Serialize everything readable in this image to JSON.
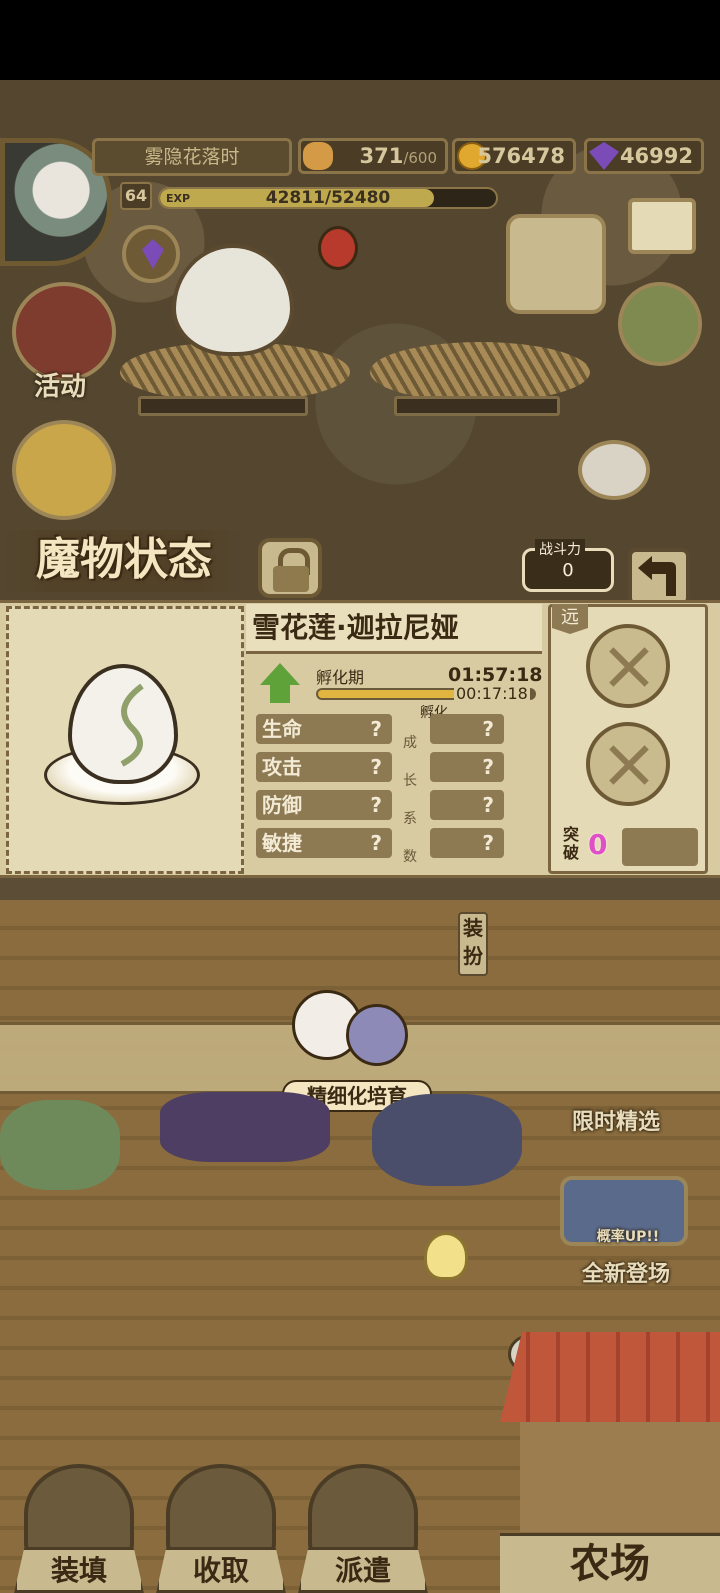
{
  "player": {
    "name": "雾隐花落时",
    "level": "64",
    "exp_label": "EXP",
    "exp_text": "42811/52480",
    "exp_progress": 0.816
  },
  "resources": {
    "bread_current": "371",
    "bread_max": "/600",
    "gold": "576478",
    "gems": "46992"
  },
  "side_menu": {
    "activity": "活动"
  },
  "status": {
    "title": "魔物状态",
    "power_label": "战斗力",
    "power_value": "0"
  },
  "monster": {
    "name": "雪花莲·迦拉尼娅",
    "hatch_label": "孵化期",
    "hatch_total": "01:57:18",
    "hatch_remaining": "00:17:18",
    "hatch_sub": "孵化",
    "hatch_progress": 0.85,
    "stats": [
      {
        "label": "生命",
        "value": "?",
        "growth": "?"
      },
      {
        "label": "攻击",
        "value": "?",
        "growth": "?"
      },
      {
        "label": "防御",
        "value": "?",
        "growth": "?"
      },
      {
        "label": "敏捷",
        "value": "?",
        "growth": "?"
      }
    ],
    "growth_chars": [
      "成",
      "长",
      "系",
      "数"
    ]
  },
  "equip": {
    "range_tag": "远",
    "breakthrough_label": "突破",
    "breakthrough_value": "0",
    "equip_label": "装扮"
  },
  "banner": {
    "label": "精细化培育"
  },
  "right_buttons": {
    "limited": "限时精选",
    "rate_up": "概率UP!!",
    "new_arrival": "全新登场"
  },
  "bottom_nav": {
    "load": "装填",
    "collect": "收取",
    "dispatch": "派遣",
    "farm": "农场"
  },
  "colors": {
    "panel": "#d8cba2",
    "accent_green": "#5fa23a",
    "break_pink": "#e051c6",
    "gem_purple": "#7b4bb8"
  }
}
